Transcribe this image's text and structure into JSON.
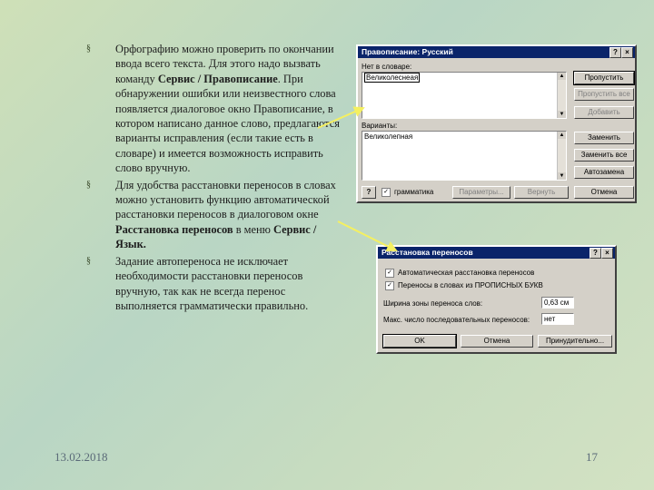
{
  "slide": {
    "bullets": [
      {
        "text_parts": [
          {
            "t": "Орфографию можно проверить по окончании ввода всего текста. Для этого надо вызвать команду ",
            "b": false
          },
          {
            "t": "Сервис / Правописание",
            "b": true
          },
          {
            "t": ". При обнаружении ошибки или неизвестного слова появляется диалоговое окно Правописание, в котором написано данное слово, предлагаются варианты исправления (если такие есть в словаре) и имеется возможность исправить слово вручную.",
            "b": false
          }
        ]
      },
      {
        "text_parts": [
          {
            "t": "Для удобства расстановки переносов в словах можно установить функцию автоматической расстановки переносов в диалоговом окне ",
            "b": false
          },
          {
            "t": "Расстановка переносов",
            "b": true
          },
          {
            "t": " в меню ",
            "b": false
          },
          {
            "t": "Сервис / Язык.",
            "b": true
          }
        ]
      },
      {
        "text_parts": [
          {
            "t": "Задание автопереноса не исключает необходимости расстановки переносов вручную, так как не всегда перенос выполняется грамматически правильно.",
            "b": false
          }
        ]
      }
    ],
    "bullet_mark": "§",
    "date": "13.02.2018",
    "page_number": "17"
  },
  "spell_dialog": {
    "title": "Правописание: Русский",
    "help": "?",
    "close": "×",
    "not_in_dict_label": "Нет в словаре:",
    "not_in_dict_value": "Великолеснеая",
    "suggestions_label": "Варианты:",
    "suggestion_value": "Великолепная",
    "buttons": {
      "skip": "Пропустить",
      "skip_all": "Пропустить все",
      "add": "Добавить",
      "change": "Заменить",
      "change_all": "Заменить все",
      "autocorrect": "Автозамена",
      "params": "Параметры...",
      "undo": "Вернуть",
      "cancel": "Отмена"
    },
    "grammar_label": "грамматика"
  },
  "hyph_dialog": {
    "title": "Расстановка переносов",
    "help": "?",
    "close": "×",
    "auto_label": "Автоматическая расстановка переносов",
    "caps_label": "Переносы в словах из ПРОПИСНЫХ БУКВ",
    "zone_label": "Ширина зоны переноса слов:",
    "zone_value": "0,63 см",
    "max_label": "Макс. число последовательных переносов:",
    "max_value": "нет",
    "buttons": {
      "ok": "OK",
      "cancel": "Отмена",
      "manual": "Принудительно..."
    }
  },
  "colors": {
    "title_bar": "#0a246a",
    "arrow": "#f5f060"
  }
}
